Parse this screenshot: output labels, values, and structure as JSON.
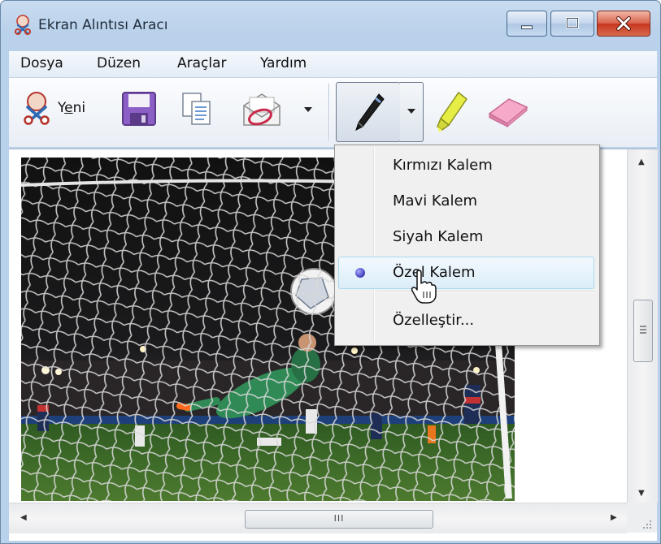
{
  "window": {
    "title": "Ekran Alıntısı Aracı",
    "controls": {
      "minimize": "minimize",
      "maximize": "maximize",
      "close": "close"
    }
  },
  "menubar": {
    "items": [
      {
        "label": "Dosya"
      },
      {
        "label": "Düzen"
      },
      {
        "label": "Araçlar"
      },
      {
        "label": "Yardım"
      }
    ]
  },
  "toolbar": {
    "new_label_prefix": "Y",
    "new_label_mnemonic": "e",
    "new_label_suffix": "ni",
    "icons": [
      "scissors-icon",
      "save-icon",
      "copy-icon",
      "send-mail-icon",
      "pen-icon",
      "highlighter-icon",
      "eraser-icon"
    ]
  },
  "pen_menu": {
    "items": [
      {
        "label": "Kırmızı Kalem",
        "selected": false
      },
      {
        "label": "Mavi Kalem",
        "selected": false
      },
      {
        "label": "Siyah Kalem",
        "selected": false
      },
      {
        "label": "Özel Kalem",
        "selected": true
      },
      {
        "label": "Özelleştir..."
      }
    ]
  },
  "scrollbar": {
    "hthumb_grip": "III"
  },
  "colors": {
    "frame": "#b9d1ea",
    "menu_highlight": "#dcedf9",
    "radio": "#3b3cb8"
  }
}
